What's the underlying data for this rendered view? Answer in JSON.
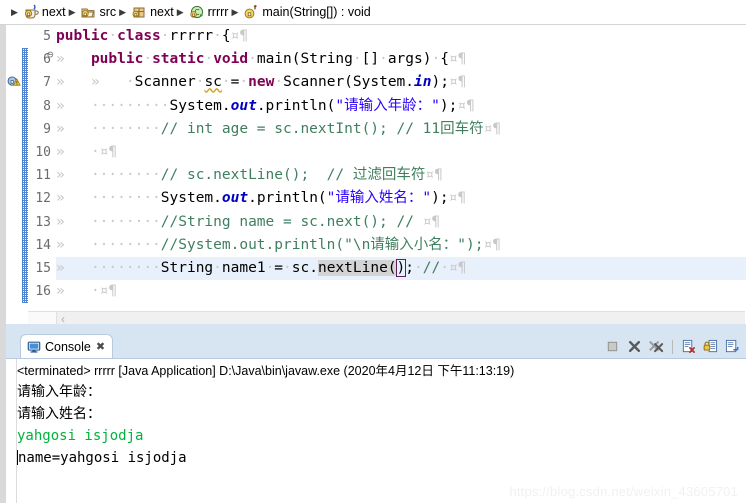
{
  "breadcrumb": {
    "items": [
      {
        "icon": "java-project-icon",
        "label": "next"
      },
      {
        "icon": "source-folder-icon",
        "label": "src"
      },
      {
        "icon": "package-icon",
        "label": "next"
      },
      {
        "icon": "java-class-icon",
        "label": "rrrrr"
      },
      {
        "icon": "java-method-icon",
        "label": "main(String[]) : void"
      }
    ],
    "separator": "▶"
  },
  "editor": {
    "first_line_number": 5,
    "lines": [
      {
        "num": "5",
        "fold": "",
        "current": false,
        "marker": ""
      },
      {
        "num": "6",
        "fold": "⊖",
        "current": false,
        "marker": ""
      },
      {
        "num": "7",
        "fold": "",
        "current": false,
        "marker": "warning-icon"
      },
      {
        "num": "8",
        "fold": "",
        "current": false,
        "marker": ""
      },
      {
        "num": "9",
        "fold": "",
        "current": false,
        "marker": ""
      },
      {
        "num": "10",
        "fold": "",
        "current": false,
        "marker": ""
      },
      {
        "num": "11",
        "fold": "",
        "current": false,
        "marker": ""
      },
      {
        "num": "12",
        "fold": "",
        "current": false,
        "marker": ""
      },
      {
        "num": "13",
        "fold": "",
        "current": false,
        "marker": ""
      },
      {
        "num": "14",
        "fold": "",
        "current": false,
        "marker": ""
      },
      {
        "num": "15",
        "fold": "",
        "current": true,
        "marker": ""
      },
      {
        "num": "16",
        "fold": "",
        "current": false,
        "marker": ""
      }
    ],
    "code_text": {
      "l5": "public class rrrrr {",
      "l6": "    public static void main(String [] args) {",
      "l7": "        Scanner sc = new Scanner(System.in);",
      "l8": "            System.out.println(\"请输入年龄：\");",
      "l9": "            // int age = sc.nextInt(); // 11回车符",
      "l10": " ",
      "l11": "            // sc.nextLine();  // 过滤回车符",
      "l12": "            System.out.println(\"请输入姓名：\");",
      "l13": "            //String name = sc.next(); // ",
      "l14": "            //System.out.println(\"\\n请输入小名：\");",
      "l15": "            String name1 = sc.nextLine(); // ",
      "l16": " "
    },
    "tokens": {
      "kw_public": "public",
      "kw_class": "class",
      "kw_static": "static",
      "kw_void": "void",
      "kw_new": "new",
      "type_rrrrr": "rrrrr",
      "type_String": "String",
      "type_Scanner": "Scanner",
      "field_in": "in",
      "field_out": "out",
      "str_age_prompt": "\"请输入年龄：\"",
      "str_name_prompt": "\"请输入姓名：\"",
      "comment_line9": "// int age = sc.nextInt(); // 11回车符",
      "comment_line11": "// sc.nextLine();  // 过滤回车符",
      "comment_line13": "//String name = sc.next(); // ",
      "comment_line14": "//System.out.println(\"\\n请输入小名：\");",
      "occurrence_nextLine": "nextLine(",
      "bracket_match": ")"
    },
    "whitespace_dot": "·",
    "tab_arrow": "»",
    "eol_space_mark": "¤",
    "pilcrow": "¶",
    "scrollbar_left_arrow": "‹"
  },
  "console": {
    "tab_label": "Console",
    "tab_icon": "console-icon",
    "close_icon": "✖",
    "toolbar": [
      {
        "name": "terminate-button",
        "glyph": "■"
      },
      {
        "name": "remove-launch-button",
        "glyph": "✖"
      },
      {
        "name": "remove-all-terminated-button",
        "glyph": "✖"
      },
      {
        "name": "clear-console-button",
        "glyph": "▤"
      },
      {
        "name": "scroll-lock-button",
        "glyph": "▤"
      },
      {
        "name": "pin-console-button",
        "glyph": "▤"
      }
    ],
    "status_line": "<terminated> rrrrr [Java Application] D:\\Java\\bin\\javaw.exe (2020年4月12日 下午11:13:19)",
    "output": [
      {
        "text": "请输入年龄：",
        "color": "#000000",
        "kind": "stdout"
      },
      {
        "text": "请输入姓名：",
        "color": "#000000",
        "kind": "stdout"
      },
      {
        "text": "yahgosi isjodja",
        "color": "#00b33c",
        "kind": "stdin"
      },
      {
        "text": "name=yahgosi isjodja",
        "color": "#000000",
        "kind": "stdout"
      }
    ]
  },
  "watermark": {
    "text": "https://blog.csdn.net/weixin_43605701"
  },
  "colors": {
    "keyword": "#7f0055",
    "string": "#2a00ff",
    "comment": "#3f7f5f",
    "field": "#0000c0",
    "console_stdin": "#00b33c",
    "tab_band": "#d7e4f2",
    "current_line": "#e8f0fb",
    "change_bar": "#2f6fce"
  }
}
